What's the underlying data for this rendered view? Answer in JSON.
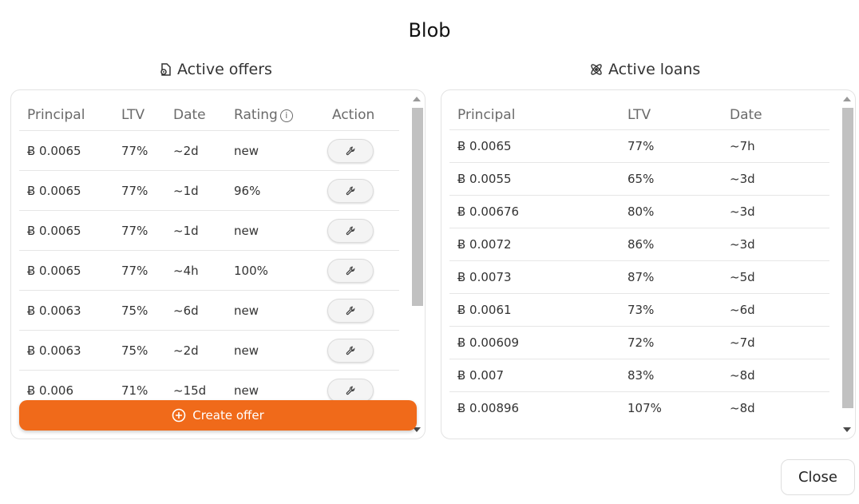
{
  "dialog": {
    "title": "Blob"
  },
  "offers": {
    "title": "Active offers",
    "icon": "offer-document-icon",
    "columns": [
      "Principal",
      "LTV",
      "Date",
      "Rating",
      "Action"
    ],
    "rows": [
      {
        "principal": "Ƀ 0.0065",
        "ltv": "77%",
        "date": "~2d",
        "rating": "new"
      },
      {
        "principal": "Ƀ 0.0065",
        "ltv": "77%",
        "date": "~1d",
        "rating": "96%"
      },
      {
        "principal": "Ƀ 0.0065",
        "ltv": "77%",
        "date": "~1d",
        "rating": "new"
      },
      {
        "principal": "Ƀ 0.0065",
        "ltv": "77%",
        "date": "~4h",
        "rating": "100%"
      },
      {
        "principal": "Ƀ 0.0063",
        "ltv": "75%",
        "date": "~6d",
        "rating": "new"
      },
      {
        "principal": "Ƀ 0.0063",
        "ltv": "75%",
        "date": "~2d",
        "rating": "new"
      },
      {
        "principal": "Ƀ 0.006",
        "ltv": "71%",
        "date": "~15d",
        "rating": "new"
      }
    ],
    "create_label": "Create offer"
  },
  "loans": {
    "title": "Active loans",
    "icon": "atom-icon",
    "columns": [
      "Principal",
      "LTV",
      "Date"
    ],
    "rows": [
      {
        "principal": "Ƀ 0.0065",
        "ltv": "77%",
        "date": "~7h"
      },
      {
        "principal": "Ƀ 0.0055",
        "ltv": "65%",
        "date": "~3d"
      },
      {
        "principal": "Ƀ 0.00676",
        "ltv": "80%",
        "date": "~3d"
      },
      {
        "principal": "Ƀ 0.0072",
        "ltv": "86%",
        "date": "~3d"
      },
      {
        "principal": "Ƀ 0.0073",
        "ltv": "87%",
        "date": "~5d"
      },
      {
        "principal": "Ƀ 0.0061",
        "ltv": "73%",
        "date": "~6d"
      },
      {
        "principal": "Ƀ 0.00609",
        "ltv": "72%",
        "date": "~7d"
      },
      {
        "principal": "Ƀ 0.007",
        "ltv": "83%",
        "date": "~8d"
      },
      {
        "principal": "Ƀ 0.00896",
        "ltv": "107%",
        "date": "~8d"
      }
    ]
  },
  "footer": {
    "close_label": "Close"
  },
  "colors": {
    "accent": "#f06a1a"
  }
}
